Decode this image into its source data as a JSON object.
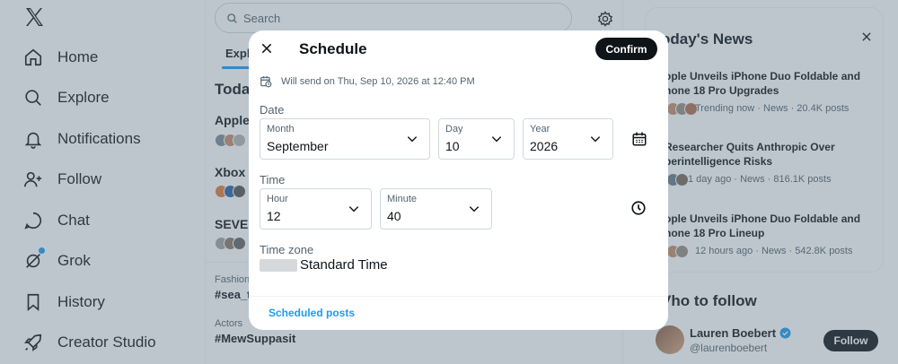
{
  "nav": {
    "items": [
      {
        "label": "Home",
        "icon": "home-icon"
      },
      {
        "label": "Explore",
        "icon": "search-icon"
      },
      {
        "label": "Notifications",
        "icon": "bell-icon"
      },
      {
        "label": "Follow",
        "icon": "person-plus-icon"
      },
      {
        "label": "Chat",
        "icon": "chat-bubble-icon"
      },
      {
        "label": "Grok",
        "icon": "grok-icon"
      },
      {
        "label": "History",
        "icon": "bookmark-icon"
      },
      {
        "label": "Creator Studio",
        "icon": "rocket-icon"
      }
    ]
  },
  "center": {
    "search_placeholder": "Search",
    "tab_label": "Explo",
    "heading": "Toda",
    "trends": [
      {
        "title": "Apple"
      },
      {
        "title": "Xbox"
      },
      {
        "title": "SEVEN"
      }
    ],
    "fashion_label": "Fashion",
    "fashion_tag": "#sea_t",
    "actors_label": "Actors",
    "actors_tag": "#MewSuppasit"
  },
  "right": {
    "news_title": "oday's News",
    "news": [
      {
        "title": "ople Unveils iPhone Duo Foldable and\nhone 18 Pro Upgrades",
        "meta": "Trending now · News · 20.4K posts"
      },
      {
        "title": "Researcher Quits Anthropic Over\nperintelligence Risks",
        "meta": "1 day ago · News · 816.1K posts"
      },
      {
        "title": "ople Unveils iPhone Duo Foldable and\nhone 18 Pro Lineup",
        "meta": "12 hours ago · News · 542.8K posts"
      }
    ],
    "who_to_follow": "Vho to follow",
    "suggestion": {
      "name": "Lauren Boebert",
      "handle": "@laurenboebert",
      "button": "Follow"
    }
  },
  "modal": {
    "title": "Schedule",
    "confirm_label": "Confirm",
    "will_send": "Will send on Thu, Sep 10, 2026 at 12:40 PM",
    "date_label": "Date",
    "month_label": "Month",
    "month_value": "September",
    "day_label": "Day",
    "day_value": "10",
    "year_label": "Year",
    "year_value": "2026",
    "time_label": "Time",
    "hour_label": "Hour",
    "hour_value": "12",
    "minute_label": "Minute",
    "minute_value": "40",
    "timezone_label": "Time zone",
    "timezone_value": "Standard Time",
    "scheduled_posts_link": "Scheduled posts"
  },
  "colors": {
    "accent": "#1d9bf0",
    "text": "#0f1419",
    "muted": "#536471",
    "border": "#cfd9de"
  }
}
